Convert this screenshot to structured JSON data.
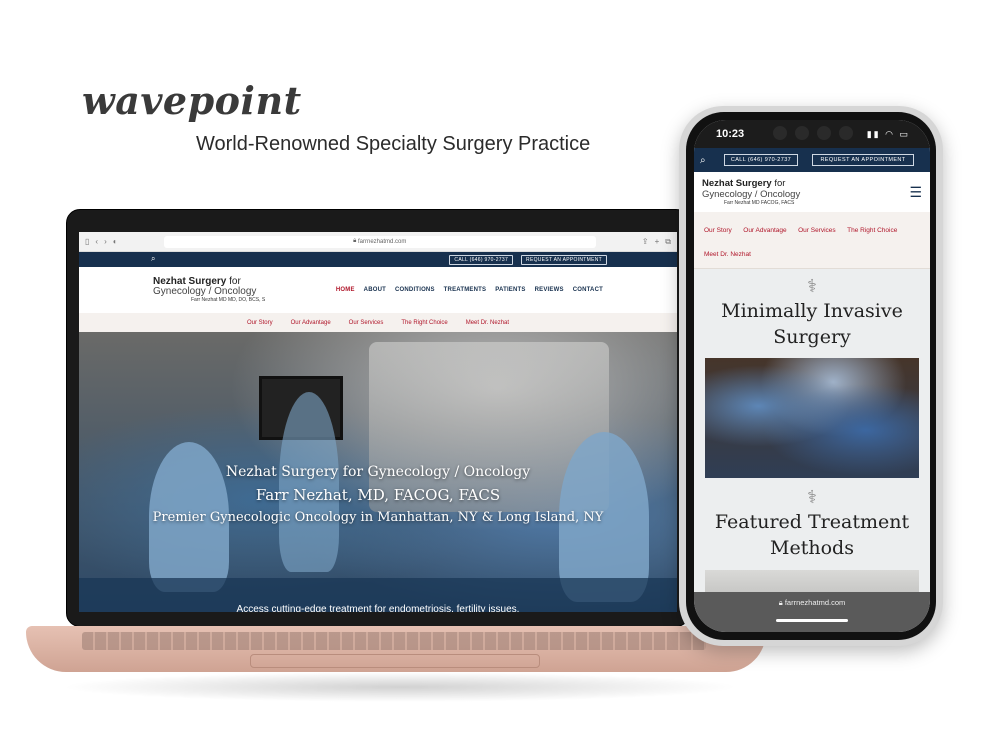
{
  "brand": {
    "logo": "wavepoint",
    "tagline": "World-Renowned Specialty Surgery Practice"
  },
  "laptop": {
    "browser": {
      "url": "farrnezhatmd.com"
    },
    "topbar": {
      "call_label": "CALL (646) 970-2737",
      "appointment_label": "REQUEST AN APPOINTMENT"
    },
    "logo": {
      "line1_bold": "Nezhat Surgery",
      "line1_rest": " for",
      "line2": "Gynecology / Oncology",
      "line3": "Farr Nezhat MD MD, DO, BCS, S"
    },
    "nav": [
      "HOME",
      "ABOUT",
      "CONDITIONS",
      "TREATMENTS",
      "PATIENTS",
      "REVIEWS",
      "CONTACT"
    ],
    "subnav": [
      "Our Story",
      "Our Advantage",
      "Our Services",
      "The Right Choice",
      "Meet Dr. Nezhat"
    ],
    "hero": {
      "line1": "Nezhat Surgery for Gynecology / Oncology",
      "line2": "Farr Nezhat, MD, FACOG, FACS",
      "line3": "Premier Gynecologic Oncology in Manhattan, NY & Long Island, NY",
      "band": "Access cutting-edge treatment for endometriosis, fertility issues,"
    }
  },
  "phone": {
    "status": {
      "time": "10:23"
    },
    "topbar": {
      "call_label": "CALL (646) 970-2737",
      "appointment_label": "REQUEST AN APPOINTMENT"
    },
    "logo": {
      "line1_bold": "Nezhat Surgery",
      "line1_rest": " for",
      "line2": "Gynecology / Oncology",
      "line3": "Farr Nezhat MD FACOG, FACS"
    },
    "subnav": [
      "Our Story",
      "Our Advantage",
      "Our Services",
      "The Right Choice",
      "Meet Dr. Nezhat"
    ],
    "section1_title": "Minimally Invasive Surgery",
    "section2_title": "Featured Treatment Methods",
    "url": "farrnezhatmd.com"
  },
  "colors": {
    "navy": "#17304e",
    "crimson": "#b0162a",
    "laptop_rose": "#e6c1b3"
  }
}
